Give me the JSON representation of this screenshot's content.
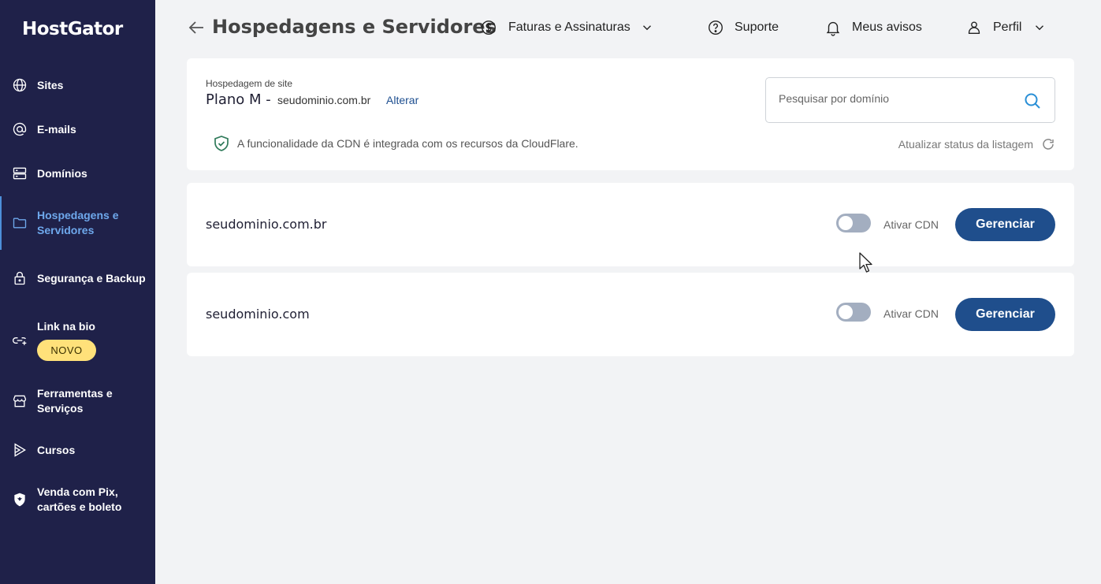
{
  "app": {
    "logo": "HostGator"
  },
  "sidebar": {
    "items": [
      {
        "label": "Sites",
        "icon": "globe-icon"
      },
      {
        "label": "E-mails",
        "icon": "at-icon"
      },
      {
        "label": "Domínios",
        "icon": "server-icon"
      },
      {
        "label": "Hospedagens e Servidores",
        "icon": "folder-icon",
        "active": true
      },
      {
        "label": "Segurança e Backup",
        "icon": "lock-icon"
      },
      {
        "label": "Link na bio",
        "icon": "link-plus-icon",
        "badge": "NOVO"
      },
      {
        "label": "Ferramentas e Serviços",
        "icon": "store-icon"
      },
      {
        "label": "Cursos",
        "icon": "play-icon"
      },
      {
        "label": "Venda com Pix, cartões e boleto",
        "icon": "shield-bird-icon"
      }
    ]
  },
  "header": {
    "title": "Hospedagens e Servidores",
    "links": [
      {
        "label": "Faturas e Assinaturas",
        "icon": "dollar-circle-icon"
      },
      {
        "label": "Suporte",
        "icon": "help-circle-icon"
      },
      {
        "label": "Meus avisos",
        "icon": "bell-icon"
      },
      {
        "label": "Perfil",
        "icon": "user-icon"
      }
    ]
  },
  "plan": {
    "caption": "Hospedagem de site",
    "name": "Plano M -",
    "domain": "seudominio.com.br",
    "change_label": "Alterar",
    "search_placeholder": "Pesquisar por domínio",
    "cdn_note": "A funcionalidade da CDN é integrada com os recursos da CloudFlare.",
    "refresh_label": "Atualizar status da listagem"
  },
  "domains": [
    {
      "name": "seudominio.com.br",
      "toggle_label": "Ativar CDN",
      "cdn_enabled": false,
      "button": "Gerenciar"
    },
    {
      "name": "seudominio.com",
      "toggle_label": "Ativar CDN",
      "cdn_enabled": false,
      "button": "Gerenciar"
    }
  ],
  "colors": {
    "sidebar_bg": "#1f2149",
    "accent": "#1f4e8c",
    "active_nav": "#6ea8ec",
    "badge": "#ffe17a"
  }
}
